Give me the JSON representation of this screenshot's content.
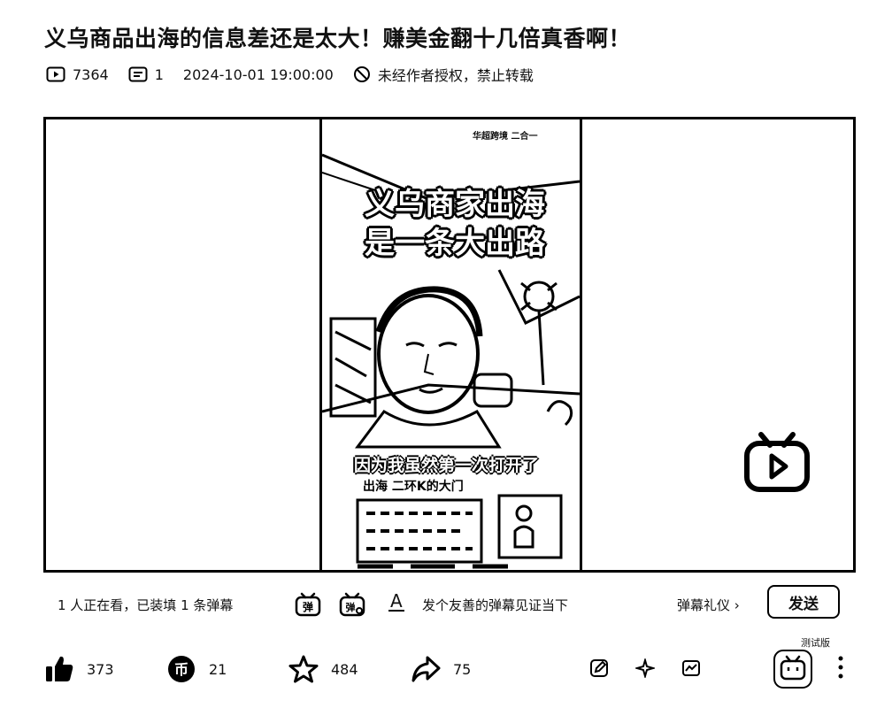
{
  "video": {
    "title": "义乌商品出海的信息差还是太大！赚美金翻十几倍真香啊！",
    "views": "7364",
    "comments": "1",
    "published": "2024-10-01 19:00:00",
    "copyright": "未经作者授权，禁止转载"
  },
  "frame": {
    "headline_line1": "义乌商家出海",
    "headline_line2": "是一条大出路",
    "caption_main": "因为我虽然第一次打开了",
    "caption_sub": "出海 二环K的大门",
    "watermark": "华超跨境  二合一"
  },
  "danmaku": {
    "viewers_text": "1 人正在看，已装填 1 条弹幕",
    "toggle_icon_label": "弹",
    "settings_icon_label": "弹",
    "input_placeholder": "发个友善的弹幕见证当下",
    "etiquette_label": "弹幕礼仪 ›",
    "send_label": "发送"
  },
  "toolbar": {
    "test_label": "测试版",
    "like_count": "373",
    "coin_count": "21",
    "favorite_count": "484",
    "share_count": "75"
  },
  "icons": {
    "views": "play-box-icon",
    "comments": "comment-box-icon",
    "copyright": "no-entry-icon",
    "like": "thumbs-up-icon",
    "coin": "coin-icon",
    "favorite": "star-icon",
    "share": "share-arrow-icon",
    "note": "note-edit-icon",
    "magic": "sparkle-icon",
    "stats": "chart-icon",
    "tv": "bilibili-tv-icon",
    "more": "more-vertical-icon"
  },
  "colors": {
    "ink": "#111111",
    "background": "#ffffff"
  }
}
